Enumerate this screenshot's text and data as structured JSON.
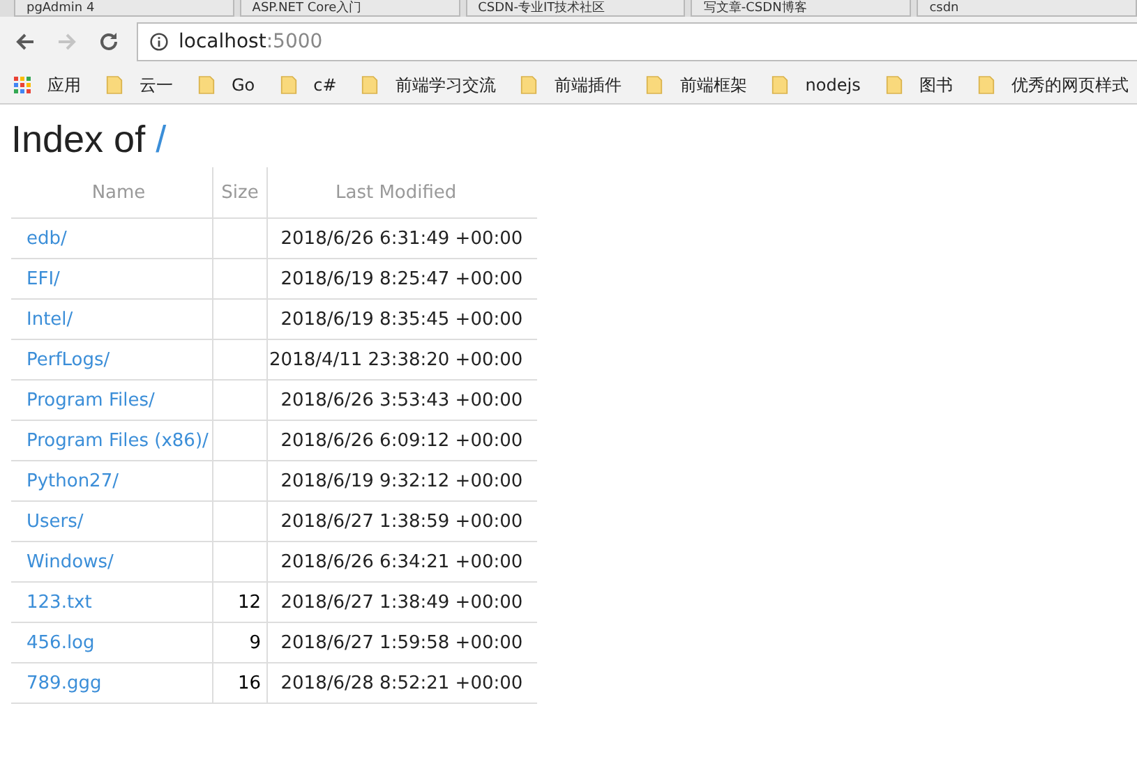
{
  "tabs": [
    {
      "title": "pgAdmin 4",
      "selected": false
    },
    {
      "title": "ASP.NET Core入门",
      "selected": false
    },
    {
      "title": "CSDN-专业IT技术社区",
      "selected": false
    },
    {
      "title": "写文章-CSDN博客",
      "selected": false
    },
    {
      "title": "csdn",
      "selected": false
    }
  ],
  "address_bar": {
    "host": "localhost",
    "port": ":5000"
  },
  "bookmarks": [
    {
      "label": "应用",
      "kind": "apps"
    },
    {
      "label": "云一",
      "kind": "folder"
    },
    {
      "label": "Go",
      "kind": "folder"
    },
    {
      "label": "c#",
      "kind": "folder"
    },
    {
      "label": "前端学习交流",
      "kind": "folder"
    },
    {
      "label": "前端插件",
      "kind": "folder"
    },
    {
      "label": "前端框架",
      "kind": "folder"
    },
    {
      "label": "nodejs",
      "kind": "folder"
    },
    {
      "label": "图书",
      "kind": "folder"
    },
    {
      "label": "优秀的网页样式",
      "kind": "folder"
    }
  ],
  "page": {
    "heading": "Index of",
    "path": "/"
  },
  "table": {
    "columns": [
      "Name",
      "Size",
      "Last Modified"
    ],
    "rows": [
      {
        "name": "edb/",
        "size": "",
        "modified": "2018/6/26 6:31:49 +00:00"
      },
      {
        "name": "EFI/",
        "size": "",
        "modified": "2018/6/19 8:25:47 +00:00"
      },
      {
        "name": "Intel/",
        "size": "",
        "modified": "2018/6/19 8:35:45 +00:00"
      },
      {
        "name": "PerfLogs/",
        "size": "",
        "modified": "2018/4/11 23:38:20 +00:00"
      },
      {
        "name": "Program Files/",
        "size": "",
        "modified": "2018/6/26 3:53:43 +00:00"
      },
      {
        "name": "Program Files (x86)/",
        "size": "",
        "modified": "2018/6/26 6:09:12 +00:00"
      },
      {
        "name": "Python27/",
        "size": "",
        "modified": "2018/6/19 9:32:12 +00:00"
      },
      {
        "name": "Users/",
        "size": "",
        "modified": "2018/6/27 1:38:59 +00:00"
      },
      {
        "name": "Windows/",
        "size": "",
        "modified": "2018/6/26 6:34:21 +00:00"
      },
      {
        "name": "123.txt",
        "size": "12",
        "modified": "2018/6/27 1:38:49 +00:00"
      },
      {
        "name": "456.log",
        "size": "9",
        "modified": "2018/6/27 1:59:58 +00:00"
      },
      {
        "name": "789.ggg",
        "size": "16",
        "modified": "2018/6/28 8:52:21 +00:00"
      }
    ]
  }
}
